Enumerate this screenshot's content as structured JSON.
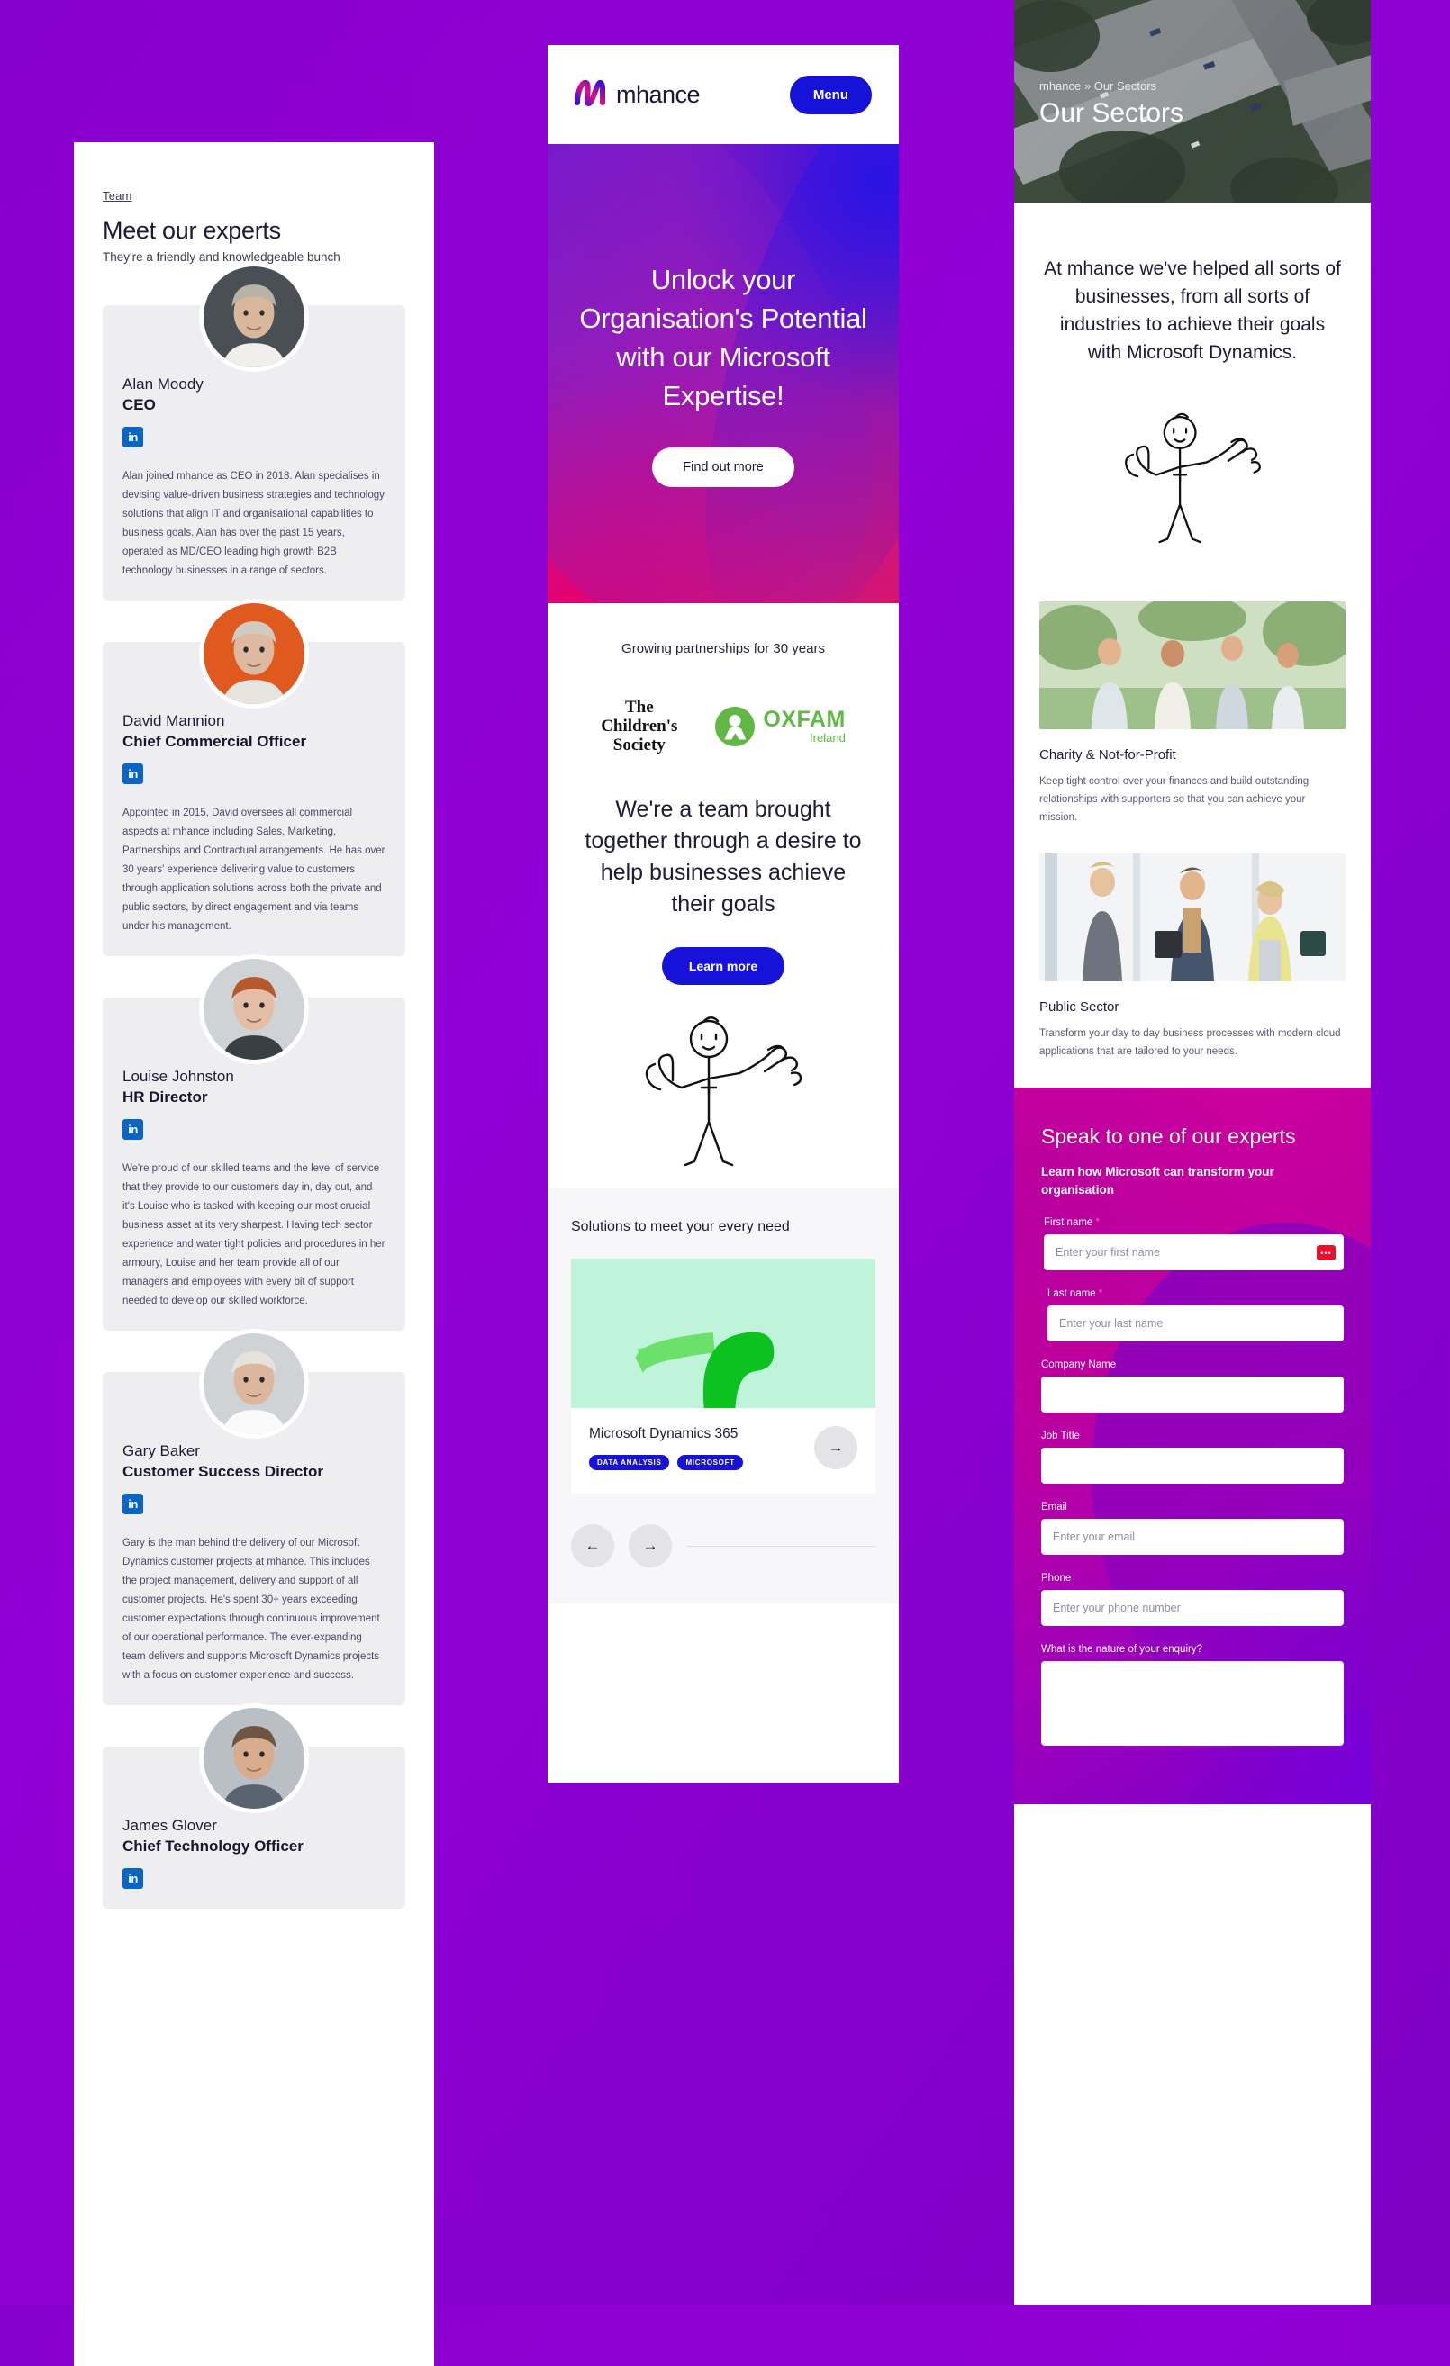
{
  "theme": {
    "page_background": "#8D00CE",
    "brand_blue": "#1712D8",
    "brand_pink": "#D6156F",
    "text_dark": "#1C1C38",
    "card_grey": "#EEEEF1",
    "linkedin_blue": "#0A66C2",
    "oxfam_green": "#61B846"
  },
  "team_panel": {
    "eyebrow": "Team",
    "title": "Meet our experts",
    "subtitle": "They're a friendly and knowledgeable bunch",
    "social_icon": "linkedin-icon",
    "social_label": "in",
    "members": [
      {
        "name": "Alan Moody",
        "role": "CEO",
        "bio": "Alan joined mhance as CEO in 2018. Alan specialises in devising value-driven business strategies and technology solutions that align IT and organisational capabilities to business goals. Alan has over the past 15 years, operated as MD/CEO leading high growth B2B technology businesses in a range of sectors."
      },
      {
        "name": "David Mannion",
        "role": "Chief Commercial Officer",
        "bio": "Appointed in 2015, David oversees all commercial aspects at mhance including Sales, Marketing, Partnerships and Contractual arrangements. He has over 30 years' experience delivering value to customers through application solutions across both the private and public sectors, by direct engagement and via teams under his management."
      },
      {
        "name": "Louise Johnston",
        "role": "HR Director",
        "bio": "We're proud of our skilled teams and the level of service that they provide to our customers day in, day out, and it's Louise who is tasked with keeping our most crucial business asset at its very sharpest. Having tech sector experience and water tight policies and procedures in her armoury, Louise and her team provide all of our managers and employees with every bit of support needed to develop our skilled workforce."
      },
      {
        "name": "Gary Baker",
        "role": "Customer Success Director",
        "bio": "Gary is the man behind the delivery of our Microsoft Dynamics customer projects at mhance. This includes the project management, delivery and support of all customer projects. He's spent 30+ years exceeding customer expectations through continuous improvement of our operational performance. The ever-expanding team delivers and supports Microsoft Dynamics projects with a focus on customer experience and success."
      },
      {
        "name": "James Glover",
        "role": "Chief Technology Officer",
        "bio": ""
      }
    ]
  },
  "home_panel": {
    "header": {
      "logo_icon": "mhance-logo-icon",
      "brand": "mhance",
      "menu_label": "Menu"
    },
    "hero": {
      "heading": "Unlock your Organisation's Potential with our Microsoft Expertise!",
      "cta": "Find out more"
    },
    "partners": {
      "label": "Growing partnerships for 30 years",
      "logos": [
        {
          "name": "The Children's Society",
          "line1": "The",
          "line2": "Children's",
          "line3": "Society"
        },
        {
          "name": "Oxfam Ireland",
          "word": "OXFAM",
          "sub": "Ireland"
        }
      ]
    },
    "about": {
      "heading": "We're a team brought together through a desire to help businesses achieve their goals",
      "cta": "Learn more",
      "illustration": "three-people-doodle-icon"
    },
    "solutions": {
      "title": "Solutions to meet your every need",
      "cards": [
        {
          "image": "green-swoosh-graphic",
          "name": "Microsoft Dynamics 365",
          "tags": [
            "DATA ANALYSIS",
            "MICROSOFT"
          ],
          "arrow_icon": "arrow-right-icon"
        }
      ],
      "prev_icon": "arrow-left-icon",
      "next_icon": "arrow-right-icon"
    }
  },
  "sectors_panel": {
    "breadcrumb": "mhance » Our Sectors",
    "title": "Our Sectors",
    "hero_image": "aerial-motorway-photo",
    "intro": "At mhance we've helped all sorts of businesses, from all sorts of industries to achieve their goals with Microsoft Dynamics.",
    "illustration": "three-people-doodle-icon",
    "sectors": [
      {
        "image": "volunteers-outdoors-photo",
        "name": "Charity & Not-for-Profit",
        "description": "Keep tight control over your finances and build outstanding relationships with supporters so that you can achieve your mission."
      },
      {
        "image": "business-people-lobby-photo",
        "name": "Public Sector",
        "description": "Transform your day to day business processes with modern cloud applications that are tailored to your needs."
      }
    ],
    "contact": {
      "heading": "Speak to one of our experts",
      "subheading": "Learn how Microsoft can transform your organisation",
      "error_badge": "•••",
      "fields": [
        {
          "label": "First name",
          "required": true,
          "placeholder": "Enter your first name",
          "value": "",
          "type": "text",
          "error": true
        },
        {
          "label": "Last name",
          "required": true,
          "placeholder": "Enter your last name",
          "value": "",
          "type": "text",
          "error": false
        },
        {
          "label": "Company Name",
          "required": false,
          "placeholder": "",
          "value": "",
          "type": "text",
          "error": false
        },
        {
          "label": "Job Title",
          "required": false,
          "placeholder": "",
          "value": "",
          "type": "text",
          "error": false
        },
        {
          "label": "Email",
          "required": false,
          "placeholder": "Enter your email",
          "value": "",
          "type": "email",
          "error": false
        },
        {
          "label": "Phone",
          "required": false,
          "placeholder": "Enter your phone number",
          "value": "",
          "type": "tel",
          "error": false
        },
        {
          "label": "What is the nature of your enquiry?",
          "required": false,
          "placeholder": "",
          "value": "",
          "type": "textarea",
          "error": false
        }
      ]
    }
  }
}
